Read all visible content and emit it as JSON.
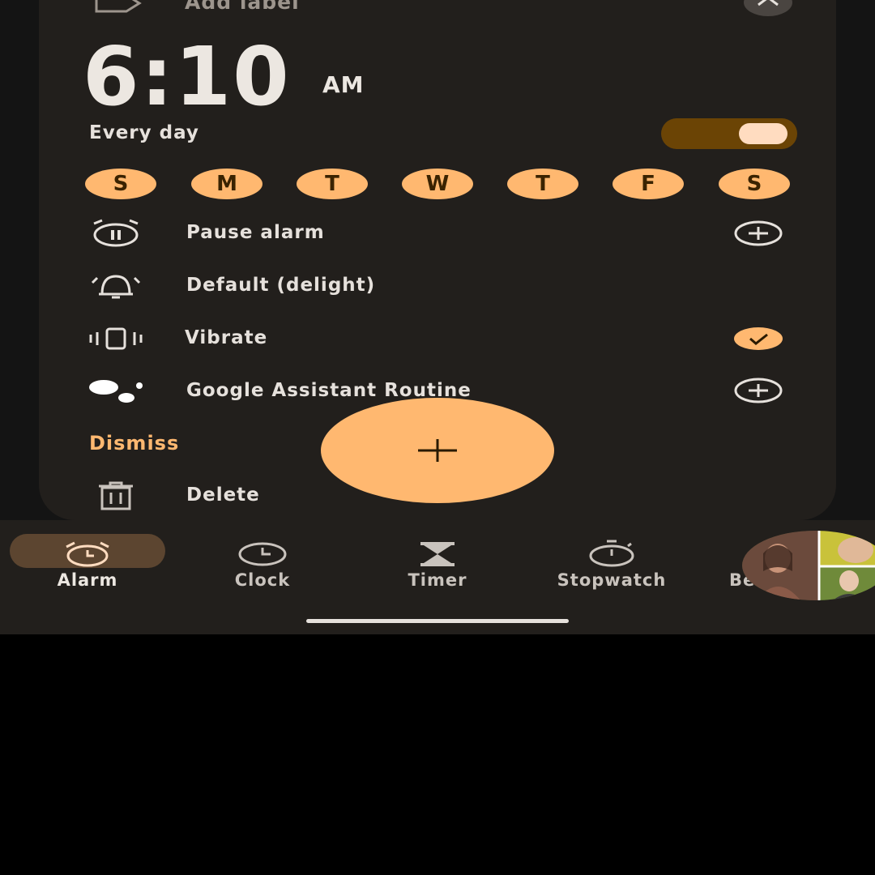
{
  "alarm": {
    "label_placeholder": "Add label",
    "time": "6:10",
    "ampm": "AM",
    "repeat_text": "Every day",
    "enabled": true,
    "days": [
      "S",
      "M",
      "T",
      "W",
      "T",
      "F",
      "S"
    ],
    "options": {
      "pause": "Pause alarm",
      "sound": "Default (delight)",
      "vibrate": "Vibrate",
      "assistant": "Google Assistant Routine"
    },
    "dismiss": "Dismiss",
    "delete": "Delete"
  },
  "nav": {
    "alarm": "Alarm",
    "clock": "Clock",
    "timer": "Timer",
    "stopwatch": "Stopwatch",
    "partial": "Be"
  },
  "colors": {
    "accent": "#ffb870",
    "card": "#221f1c",
    "toggle_track": "#6b4405",
    "toggle_knob": "#ffdcc0",
    "text": "#e6e1dc",
    "nav_active_pill": "#5c4530"
  },
  "icons": [
    "label-icon",
    "collapse-chevron-icon",
    "pause-alarm-icon",
    "bell-icon",
    "vibrate-icon",
    "google-assistant-icon",
    "add-circle-icon",
    "check-icon",
    "trash-icon",
    "add-icon",
    "alarm-icon",
    "clock-icon",
    "hourglass-icon",
    "stopwatch-icon"
  ]
}
